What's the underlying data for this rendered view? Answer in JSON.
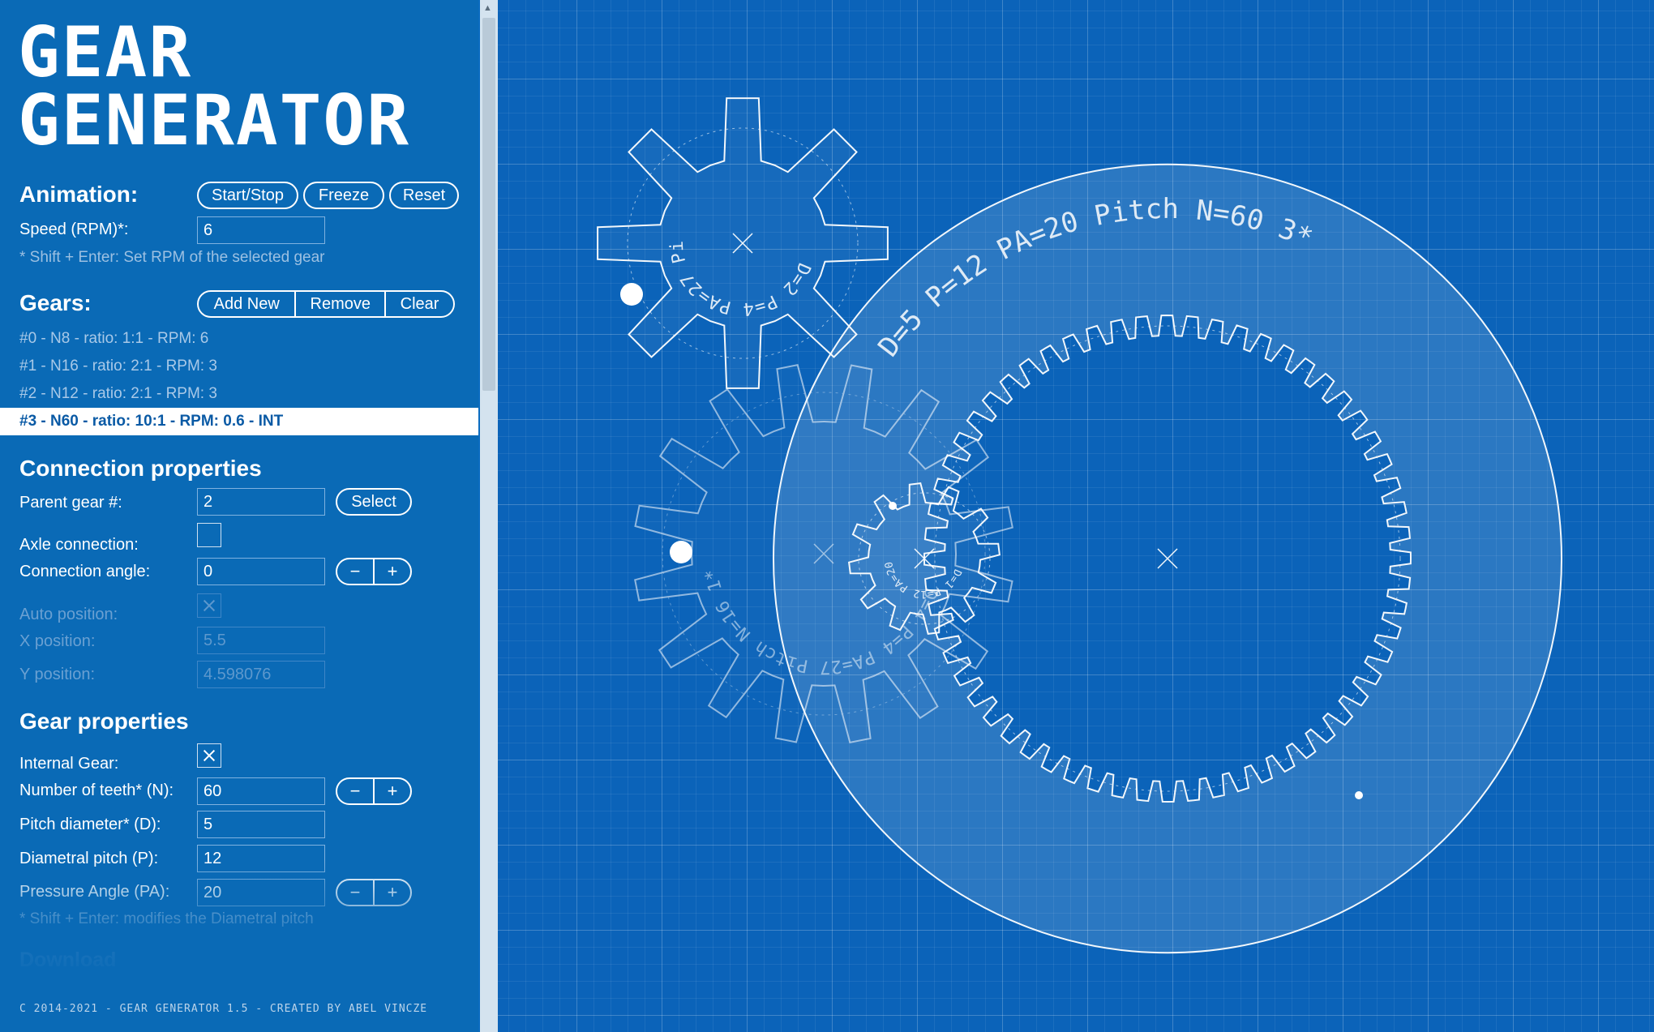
{
  "app": {
    "title_line1": "GEAR",
    "title_line2": "GENERATOR",
    "footer": "C 2014-2021 - GEAR GENERATOR 1.5 - CREATED BY ABEL VINCZE"
  },
  "animation": {
    "heading": "Animation:",
    "start_stop_label": "Start/Stop",
    "freeze_label": "Freeze",
    "reset_label": "Reset",
    "speed_label": "Speed (RPM)*:",
    "speed_value": "6",
    "speed_note": "* Shift + Enter: Set RPM of the selected gear"
  },
  "gears": {
    "heading": "Gears:",
    "add_label": "Add New",
    "remove_label": "Remove",
    "clear_label": "Clear",
    "items": [
      "#0 - N8 - ratio: 1:1 - RPM: 6",
      "#1 - N16 - ratio: 2:1 - RPM: 3",
      "#2 - N12 - ratio: 2:1 - RPM: 3",
      "#3 - N60 - ratio: 10:1 - RPM: 0.6 - INT"
    ],
    "selected_index": 3
  },
  "connection": {
    "heading": "Connection properties",
    "parent_label": "Parent gear #:",
    "parent_value": "2",
    "select_label": "Select",
    "axle_label": "Axle connection:",
    "axle_checked": false,
    "angle_label": "Connection angle:",
    "angle_value": "0",
    "auto_label": "Auto position:",
    "auto_checked": true,
    "x_label": "X position:",
    "x_value": "5.5",
    "y_label": "Y position:",
    "y_value": "4.598076"
  },
  "gear_props": {
    "heading": "Gear properties",
    "internal_label": "Internal Gear:",
    "internal_checked": true,
    "teeth_label": "Number of teeth* (N):",
    "teeth_value": "60",
    "pitch_d_label": "Pitch diameter* (D):",
    "pitch_d_value": "5",
    "dp_label": "Diametral pitch (P):",
    "dp_value": "12",
    "pa_label": "Pressure Angle (PA):",
    "pa_value": "20",
    "pa_note": "* Shift + Enter: modifies the Diametral pitch",
    "download_label": "Download"
  },
  "stepper": {
    "minus": "−",
    "plus": "+"
  },
  "canvas": {
    "gears": [
      {
        "id": "#0",
        "teeth": 8,
        "label": "D=2 P=4 PA=27 Pitch N=8 0*"
      },
      {
        "id": "#1",
        "teeth": 16,
        "label": "D=4 P=4 PA=27 Pitch N=16 1*"
      },
      {
        "id": "#2",
        "teeth": 12,
        "label": "D=1 P=12 PA=20 Pitch N=12 2*"
      },
      {
        "id": "#3",
        "teeth": 60,
        "internal": true,
        "label": "D=5 P=12 PA=20 Pitch N=60 3*"
      }
    ],
    "colors": {
      "background": "#0b63b9",
      "line": "#ffffff",
      "panel": "#0a6ab6"
    }
  }
}
